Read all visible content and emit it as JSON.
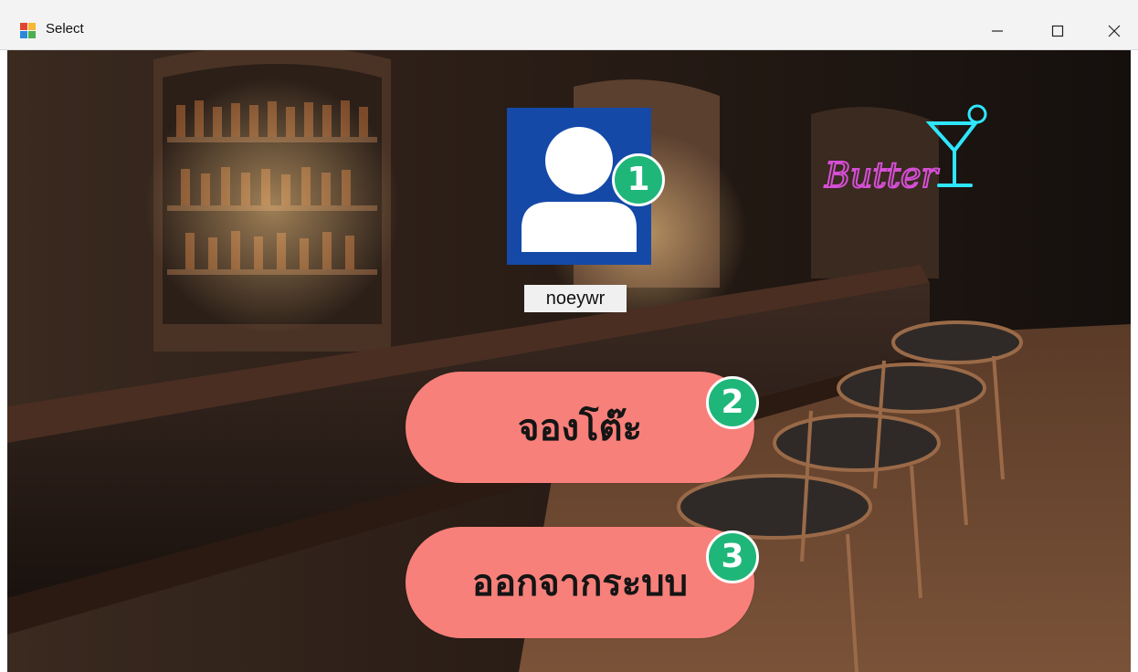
{
  "window": {
    "title": "Select",
    "icon": "windows-form-icon",
    "controls": [
      "minimize-icon",
      "maximize-icon",
      "close-icon"
    ]
  },
  "profile": {
    "avatar_icon": "user-avatar-icon",
    "avatar_color": "#1449a8",
    "username": "noeywr"
  },
  "actions": {
    "reserve_label": "จองโต๊ะ",
    "logout_label": "ออกจากระบบ",
    "button_color": "#f8807a"
  },
  "markers": [
    "1",
    "2",
    "3"
  ],
  "marker_color": "#1fb67a",
  "background": {
    "scene": "bar-interior-image",
    "neon_sign": "Butter"
  }
}
